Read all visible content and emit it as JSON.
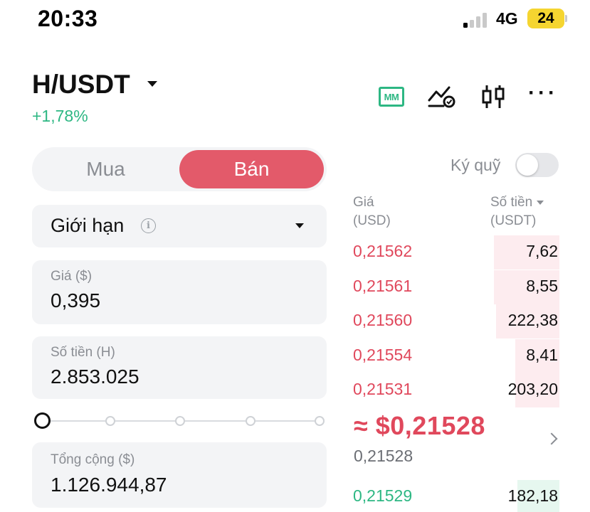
{
  "status_bar": {
    "time": "20:33",
    "network": "4G",
    "battery": "24"
  },
  "header": {
    "pair": "H/USDT",
    "change": "+1,78%",
    "tools": {
      "mm_label": "MM",
      "more_label": "···"
    }
  },
  "side_toggle": {
    "buy_label": "Mua",
    "sell_label": "Bán",
    "selected": "sell"
  },
  "order_type": {
    "label": "Giới hạn",
    "info_glyph": "i"
  },
  "price_field": {
    "label": "Giá ($)",
    "value": "0,395"
  },
  "amount_field": {
    "label": "Số tiền (H)",
    "value": "2.853.025"
  },
  "slider": {
    "stops": [
      0,
      25,
      50,
      75,
      100
    ],
    "value_percent": 0
  },
  "total_field": {
    "label": "Tổng cộng ($)",
    "value": "1.126.944,87"
  },
  "margin": {
    "label": "Ký quỹ",
    "enabled": false
  },
  "order_book": {
    "price_header_1": "Giá",
    "price_header_2": "(USD)",
    "amount_header_1": "Số tiền",
    "amount_header_2": "(USDT)",
    "asks": [
      {
        "price": "0,21562",
        "amount": "7,62",
        "depth": 0.31
      },
      {
        "price": "0,21561",
        "amount": "8,55",
        "depth": 0.31
      },
      {
        "price": "0,21560",
        "amount": "222,38",
        "depth": 0.3
      },
      {
        "price": "0,21554",
        "amount": "8,41",
        "depth": 0.21
      },
      {
        "price": "0,21531",
        "amount": "203,20",
        "depth": 0.21
      }
    ],
    "last_price": "≈ $0,21528",
    "mark_price": "0,21528",
    "bids": [
      {
        "price": "0,21529",
        "amount": "182,18",
        "depth": 0.2
      }
    ]
  },
  "colors": {
    "sell": "#e35a6a",
    "ask_text": "#e0485c",
    "ask_depth": "#fdecef",
    "bid_text": "#2db783",
    "bid_depth": "#e6f7ef",
    "positive": "#2db783"
  }
}
